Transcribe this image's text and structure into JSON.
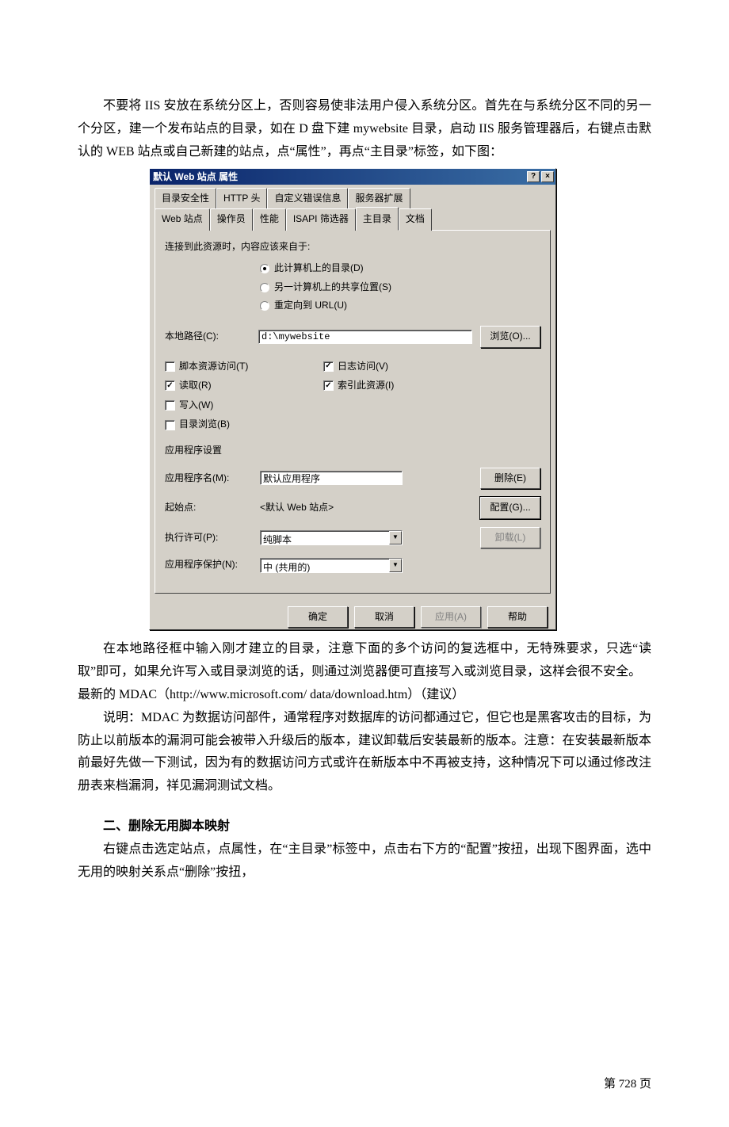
{
  "para1": "不要将 IIS 安放在系统分区上，否则容易使非法用户侵入系统分区。首先在与系统分区不同的另一个分区，建一个发布站点的目录，如在 D 盘下建 mywebsite 目录，启动 IIS 服务管理器后，右键点击默认的 WEB 站点或自己新建的站点，点“属性”，再点“主目录”标签，如下图：",
  "dialog": {
    "title": "默认 Web 站点 属性",
    "help_icon": "?",
    "close_icon": "×",
    "tabs_row1": [
      "目录安全性",
      "HTTP 头",
      "自定义错误信息",
      "服务器扩展"
    ],
    "tabs_row2": [
      "Web 站点",
      "操作员",
      "性能",
      "ISAPI 筛选器",
      "主目录",
      "文档"
    ],
    "connect_label": "连接到此资源时，内容应该来自于:",
    "radios": [
      {
        "label": "此计算机上的目录(D)",
        "checked": true
      },
      {
        "label": "另一计算机上的共享位置(S)",
        "checked": false
      },
      {
        "label": "重定向到 URL(U)",
        "checked": false
      }
    ],
    "local_path_label": "本地路径(C):",
    "local_path_value": "d:\\mywebsite",
    "browse_btn": "浏览(O)...",
    "checks_left": [
      {
        "label": "脚本资源访问(T)",
        "checked": false
      },
      {
        "label": "读取(R)",
        "checked": true
      },
      {
        "label": "写入(W)",
        "checked": false
      },
      {
        "label": "目录浏览(B)",
        "checked": false
      }
    ],
    "checks_right": [
      {
        "label": "日志访问(V)",
        "checked": true
      },
      {
        "label": "索引此资源(I)",
        "checked": true
      }
    ],
    "app_section_label": "应用程序设置",
    "app_name_label": "应用程序名(M):",
    "app_name_value": "默认应用程序",
    "start_point_label": "起始点:",
    "start_point_value": "<默认 Web 站点>",
    "exec_perm_label": "执行许可(P):",
    "exec_perm_value": "纯脚本",
    "app_protect_label": "应用程序保护(N):",
    "app_protect_value": "中 (共用的)",
    "remove_btn": "删除(E)",
    "config_btn": "配置(G)...",
    "unload_btn": "卸载(L)",
    "footer": {
      "ok": "确定",
      "cancel": "取消",
      "apply": "应用(A)",
      "help": "帮助"
    }
  },
  "para2": "在本地路径框中输入刚才建立的目录，注意下面的多个访问的复选框中，无特殊要求，只选“读取”即可，如果允许写入或目录浏览的话，则通过浏览器便可直接写入或浏览目录，这样会很不安全。",
  "para3": "最新的 MDAC（http://www.microsoft.com/ data/download.htm）（建议）",
  "para4": "说明：MDAC 为数据访问部件，通常程序对数据库的访问都通过它，但它也是黑客攻击的目标，为防止以前版本的漏洞可能会被带入升级后的版本，建议卸载后安装最新的版本。注意：在安装最新版本前最好先做一下测试，因为有的数据访问方式或许在新版本中不再被支持，这种情况下可以通过修改注册表来档漏洞，祥见漏洞测试文档。",
  "heading": "二、删除无用脚本映射",
  "para5": "右键点击选定站点，点属性，在“主目录”标签中，点击右下方的“配置”按扭，出现下图界面，选中无用的映射关系点“删除”按扭，",
  "page_num": "第 728 页"
}
